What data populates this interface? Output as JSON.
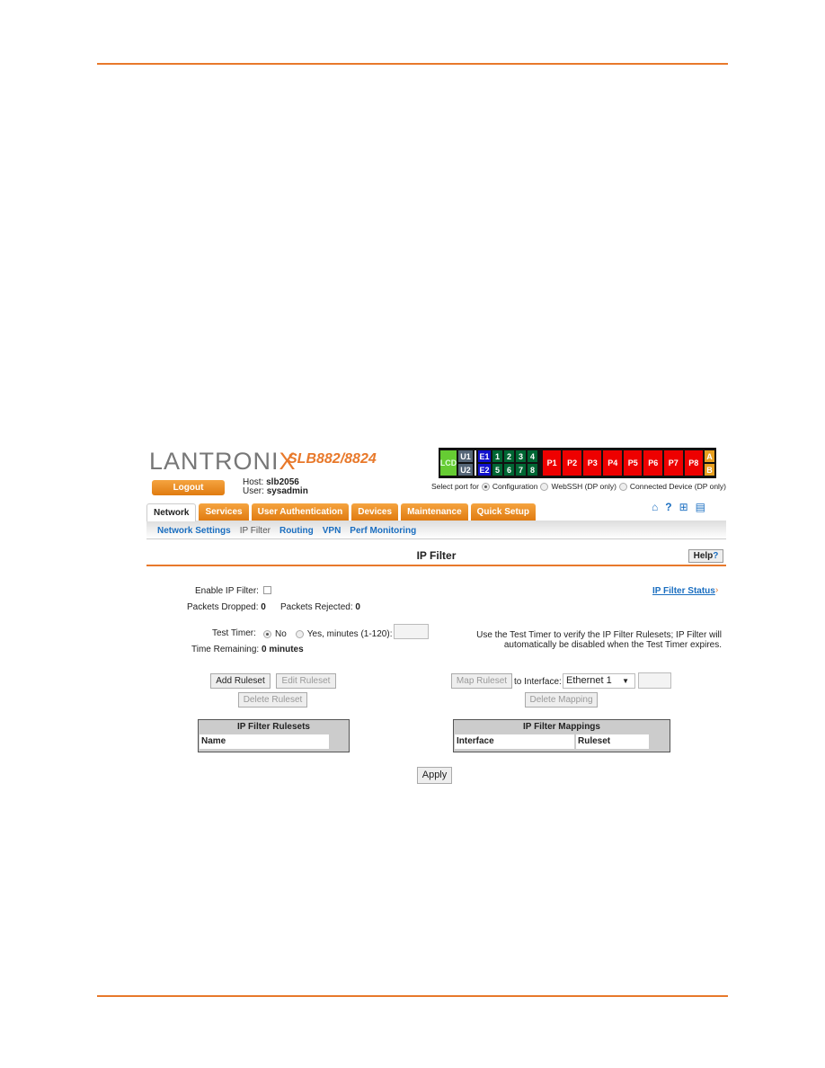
{
  "header": {
    "logo": "LANTRONIX",
    "model": "SLB882/8824",
    "logout": "Logout",
    "host_label": "Host:",
    "host": "slb2056",
    "user_label": "User:",
    "user": "sysadmin"
  },
  "ports": {
    "lcd": "LCD",
    "u": [
      "U1",
      "U2"
    ],
    "e": [
      "E1",
      "E2"
    ],
    "n": [
      "1",
      "2",
      "3",
      "4",
      "5",
      "6",
      "7",
      "8"
    ],
    "p": [
      "P1",
      "P2",
      "P3",
      "P4",
      "P5",
      "P6",
      "P7",
      "P8"
    ],
    "ab": [
      "A",
      "B"
    ],
    "select_label": "Select port for",
    "options": [
      "Configuration",
      "WebSSH (DP only)",
      "Connected Device (DP only)"
    ],
    "selected": "Configuration"
  },
  "tabs": [
    "Network",
    "Services",
    "User Authentication",
    "Devices",
    "Maintenance",
    "Quick Setup"
  ],
  "subnav": [
    "Network Settings",
    "IP Filter",
    "Routing",
    "VPN",
    "Perf Monitoring"
  ],
  "page": {
    "title": "IP Filter",
    "help": "Help",
    "status_link": "IP Filter Status",
    "enable_label": "Enable IP Filter:",
    "dropped_label": "Packets Dropped:",
    "dropped": "0",
    "rejected_label": "Packets Rejected:",
    "rejected": "0",
    "timer_label": "Test Timer:",
    "timer_no": "No",
    "timer_yes": "Yes, minutes (1-120):",
    "remaining_label": "Time Remaining:",
    "remaining": "0 minutes",
    "note1": "Use the Test Timer to verify the IP Filter Rulesets; IP Filter will",
    "note2": "automatically be disabled when the Test Timer expires.",
    "add": "Add Ruleset",
    "edit": "Edit Ruleset",
    "delete": "Delete Ruleset",
    "map": "Map Ruleset",
    "to_iface": "to Interface:",
    "iface": "Ethernet 1",
    "delete_map": "Delete Mapping",
    "rulesets_title": "IP Filter Rulesets",
    "rulesets_col": "Name",
    "mappings_title": "IP Filter Mappings",
    "mappings_cols": [
      "Interface",
      "Ruleset"
    ],
    "apply": "Apply"
  }
}
